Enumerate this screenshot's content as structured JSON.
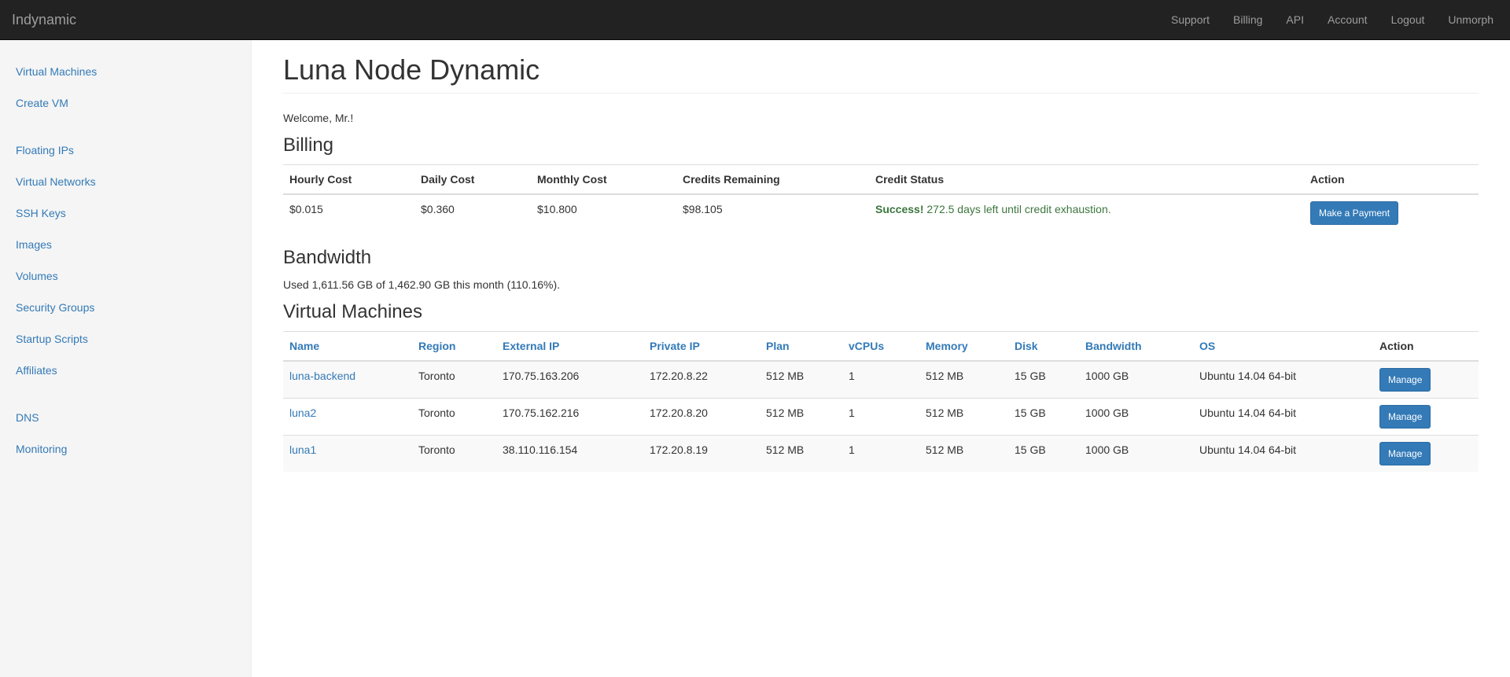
{
  "navbar": {
    "brand": "Indynamic",
    "links": [
      "Support",
      "Billing",
      "API",
      "Account",
      "Logout",
      "Unmorph"
    ]
  },
  "sidebar": {
    "groups": [
      [
        "Virtual Machines",
        "Create VM"
      ],
      [
        "Floating IPs",
        "Virtual Networks",
        "SSH Keys",
        "Images",
        "Volumes",
        "Security Groups",
        "Startup Scripts",
        "Affiliates"
      ],
      [
        "DNS",
        "Monitoring"
      ]
    ]
  },
  "main": {
    "title": "Luna Node Dynamic",
    "welcome": "Welcome, Mr.!",
    "billing": {
      "heading": "Billing",
      "columns": [
        "Hourly Cost",
        "Daily Cost",
        "Monthly Cost",
        "Credits Remaining",
        "Credit Status",
        "Action"
      ],
      "row": {
        "hourly": "$0.015",
        "daily": "$0.360",
        "monthly": "$10.800",
        "credits": "$98.105",
        "status_strong": "Success!",
        "status_text": " 272.5 days left until credit exhaustion.",
        "action_label": "Make a Payment"
      }
    },
    "bandwidth": {
      "heading": "Bandwidth",
      "text": "Used 1,611.56 GB of 1,462.90 GB this month (110.16%)."
    },
    "vms": {
      "heading": "Virtual Machines",
      "columns": [
        "Name",
        "Region",
        "External IP",
        "Private IP",
        "Plan",
        "vCPUs",
        "Memory",
        "Disk",
        "Bandwidth",
        "OS",
        "Action"
      ],
      "rows": [
        {
          "name": "luna-backend",
          "region": "Toronto",
          "external_ip": "170.75.163.206",
          "private_ip": "172.20.8.22",
          "plan": "512 MB",
          "vcpus": "1",
          "memory": "512 MB",
          "disk": "15 GB",
          "bandwidth": "1000 GB",
          "os": "Ubuntu 14.04 64-bit",
          "action": "Manage"
        },
        {
          "name": "luna2",
          "region": "Toronto",
          "external_ip": "170.75.162.216",
          "private_ip": "172.20.8.20",
          "plan": "512 MB",
          "vcpus": "1",
          "memory": "512 MB",
          "disk": "15 GB",
          "bandwidth": "1000 GB",
          "os": "Ubuntu 14.04 64-bit",
          "action": "Manage"
        },
        {
          "name": "luna1",
          "region": "Toronto",
          "external_ip": "38.110.116.154",
          "private_ip": "172.20.8.19",
          "plan": "512 MB",
          "vcpus": "1",
          "memory": "512 MB",
          "disk": "15 GB",
          "bandwidth": "1000 GB",
          "os": "Ubuntu 14.04 64-bit",
          "action": "Manage"
        }
      ]
    }
  },
  "colors": {
    "navbar_bg": "#222222",
    "link": "#337ab7",
    "success": "#3c763d",
    "sidebar_bg": "#f5f5f5"
  }
}
